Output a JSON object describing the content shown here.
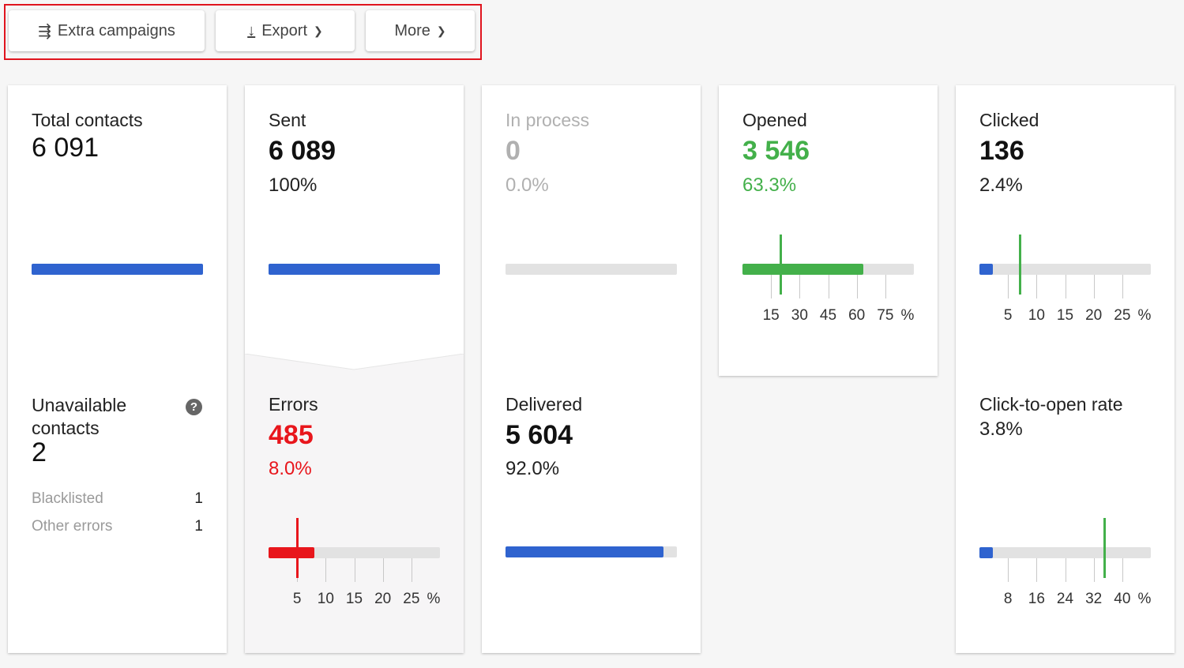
{
  "toolbar": {
    "extra_campaigns": {
      "label": "Extra campaigns",
      "icon": "campaign-arrows-icon"
    },
    "export": {
      "label": "Export",
      "icon": "download-icon"
    },
    "more": {
      "label": "More"
    }
  },
  "colors": {
    "blue": "#2f63cf",
    "green": "#43b04a",
    "red": "#e8161c",
    "track": "#e2e2e2",
    "highlight_border": "#e0141e"
  },
  "cards": {
    "total": {
      "label": "Total contacts",
      "value": "6 091",
      "progress": 100,
      "unavailable": {
        "label": "Unavailable contacts",
        "value": "2",
        "help_icon": "question-circle-icon",
        "rows": [
          {
            "label": "Blacklisted",
            "value": "1"
          },
          {
            "label": "Other errors",
            "value": "1"
          }
        ]
      }
    },
    "sent": {
      "label": "Sent",
      "value": "6 089",
      "percent": "100%",
      "progress": 100,
      "errors": {
        "label": "Errors",
        "value": "485",
        "percent": "8.0%"
      }
    },
    "in_process": {
      "label": "In process",
      "value": "0",
      "percent": "0.0%",
      "progress": 0,
      "delivered": {
        "label": "Delivered",
        "value": "5 604",
        "percent": "92.0%",
        "progress": 92
      }
    },
    "opened": {
      "label": "Opened",
      "value": "3 546",
      "percent": "63.3%"
    },
    "clicked": {
      "label": "Clicked",
      "value": "136",
      "percent": "2.4%",
      "ctor": {
        "label": "Click-to-open rate",
        "percent": "3.8%"
      }
    }
  },
  "gauges": {
    "errors": {
      "value": 8.0,
      "max": 30,
      "benchmark": 5,
      "ticks": [
        "5",
        "10",
        "15",
        "20",
        "25"
      ],
      "unit": "%",
      "color": "#e8161c",
      "marker_color": "#e8161c"
    },
    "opened": {
      "value": 63.3,
      "max": 90,
      "benchmark": 20,
      "ticks": [
        "15",
        "30",
        "45",
        "60",
        "75"
      ],
      "unit": "%",
      "color": "#43b04a",
      "marker_color": "#43b04a"
    },
    "clicked": {
      "value": 2.4,
      "max": 30,
      "benchmark": 7,
      "ticks": [
        "5",
        "10",
        "15",
        "20",
        "25"
      ],
      "unit": "%",
      "color": "#2f63cf",
      "marker_color": "#43b04a"
    },
    "ctor": {
      "value": 3.8,
      "max": 48,
      "benchmark": 35,
      "ticks": [
        "8",
        "16",
        "24",
        "32",
        "40"
      ],
      "unit": "%",
      "color": "#2f63cf",
      "marker_color": "#43b04a"
    }
  }
}
